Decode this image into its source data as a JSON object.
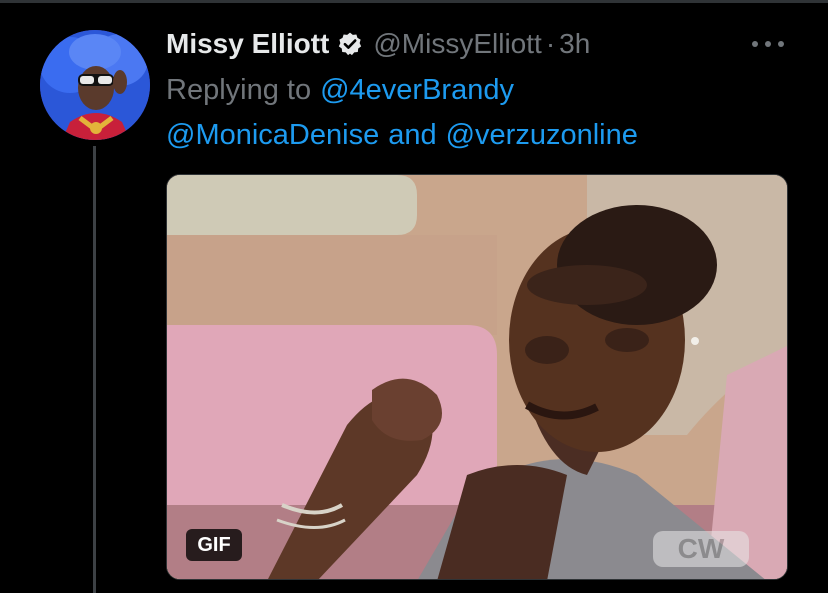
{
  "tweet": {
    "display_name": "Missy Elliott",
    "handle": "@MissyElliott",
    "separator": "·",
    "time": "3h",
    "reply_prefix": "Replying to",
    "mentions": [
      "@4everBrandy",
      "@MonicaDenise",
      "@verzuzonline"
    ],
    "mention_joiner": "and",
    "media": {
      "badge": "GIF",
      "watermark": "CW"
    }
  },
  "icons": {
    "verified": "verified-badge-icon",
    "more": "more-options-icon"
  },
  "colors": {
    "background": "#000000",
    "name": "#e7e9ea",
    "secondary_text": "#71767b",
    "link": "#1d9bf0",
    "divider": "#2f3336"
  }
}
